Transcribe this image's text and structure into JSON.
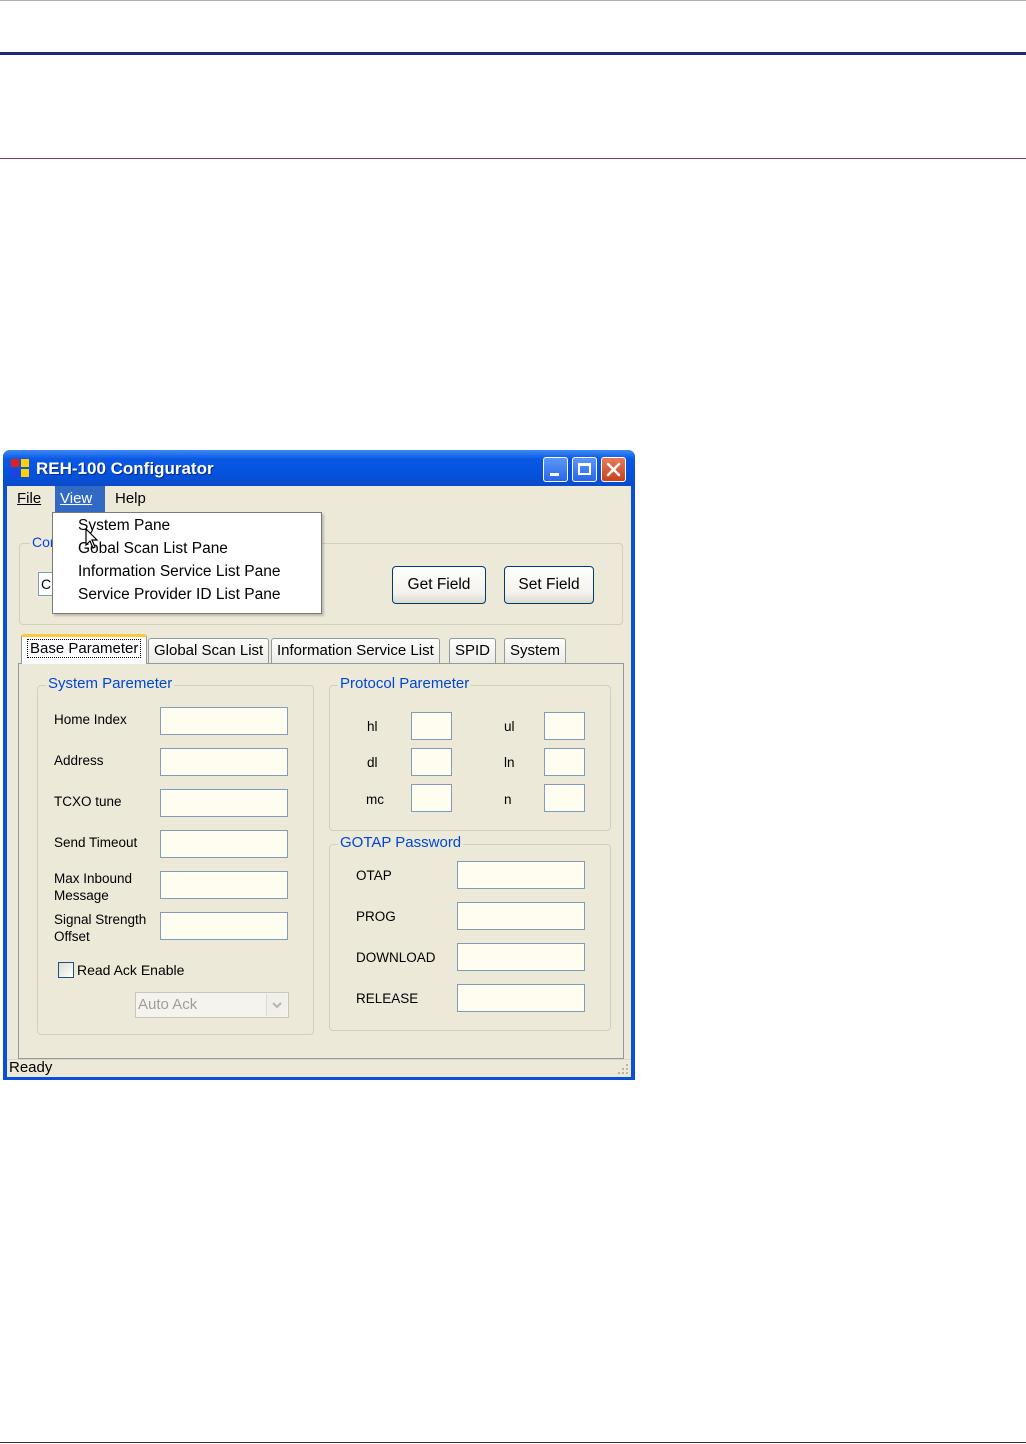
{
  "window": {
    "title": "REH-100 Configurator"
  },
  "menu": {
    "file": "File",
    "view": "View",
    "help": "Help",
    "view_items": [
      "System Pane",
      "Gobal Scan List Pane",
      "Information Service List Pane",
      "Service Provider ID List Pane"
    ]
  },
  "connection": {
    "legend": "Con",
    "port_value": "C",
    "get_field": "Get Field",
    "set_field": "Set Field"
  },
  "tabs": [
    "Base Parameter",
    "Global Scan List",
    "Information Service List",
    "SPID",
    "System"
  ],
  "system_parameter": {
    "legend": "System Paremeter",
    "home_index": "Home Index",
    "address": "Address",
    "tcxo_tune": "TCXO tune",
    "send_timeout": "Send Timeout",
    "max_inbound": "Max Inbound Message",
    "signal_strength": "Signal Strength Offset",
    "read_ack_enable": "Read Ack Enable",
    "ack_mode": "Auto Ack"
  },
  "protocol_parameter": {
    "legend": "Protocol Paremeter",
    "hl": "hl",
    "ul": "ul",
    "dl": "dl",
    "ln": "ln",
    "mc": "mc",
    "n": "n"
  },
  "gotap_password": {
    "legend": "GOTAP Password",
    "otap": "OTAP",
    "prog": "PROG",
    "download": "DOWNLOAD",
    "release": "RELEASE"
  },
  "status": {
    "text": "Ready"
  }
}
